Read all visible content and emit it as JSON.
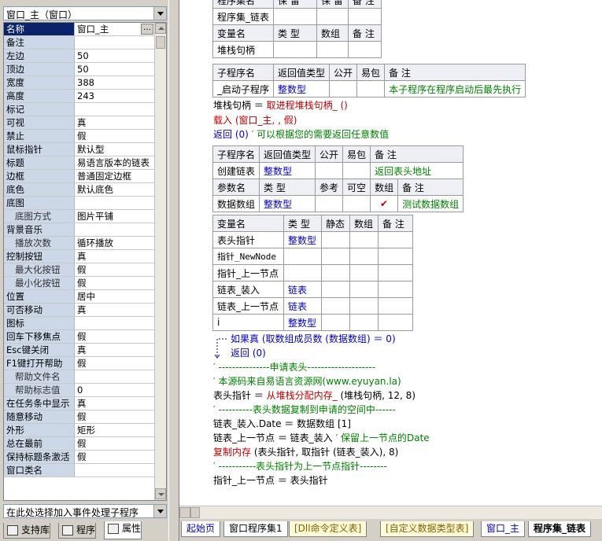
{
  "object_combo": "窗口_主（窗口）",
  "properties": [
    {
      "name": "名称",
      "value": "窗口_主",
      "selected": true,
      "button": "…"
    },
    {
      "name": "备注",
      "value": ""
    },
    {
      "name": "左边",
      "value": "50"
    },
    {
      "name": "顶边",
      "value": "50"
    },
    {
      "name": "宽度",
      "value": "388"
    },
    {
      "name": "高度",
      "value": "243"
    },
    {
      "name": "标记",
      "value": ""
    },
    {
      "name": "可视",
      "value": "真"
    },
    {
      "name": "禁止",
      "value": "假"
    },
    {
      "name": "鼠标指针",
      "value": "默认型"
    },
    {
      "name": "标题",
      "value": "易语言版本的链表"
    },
    {
      "name": "边框",
      "value": "普通固定边框"
    },
    {
      "name": "底色",
      "value": "默认底色"
    },
    {
      "name": "底图",
      "value": ""
    },
    {
      "name": "底图方式",
      "value": "图片平铺",
      "indent": true
    },
    {
      "name": "背景音乐",
      "value": ""
    },
    {
      "name": "播放次数",
      "value": "循环播放",
      "indent": true
    },
    {
      "name": "控制按钮",
      "value": "真"
    },
    {
      "name": "最大化按钮",
      "value": "假",
      "indent": true
    },
    {
      "name": "最小化按钮",
      "value": "假",
      "indent": true
    },
    {
      "name": "位置",
      "value": "居中"
    },
    {
      "name": "可否移动",
      "value": "真"
    },
    {
      "name": "图标",
      "value": ""
    },
    {
      "name": "回车下移焦点",
      "value": "假"
    },
    {
      "name": "Esc键关闭",
      "value": "真"
    },
    {
      "name": "F1键打开帮助",
      "value": "假"
    },
    {
      "name": "帮助文件名",
      "value": "",
      "indent": true
    },
    {
      "name": "帮助标志值",
      "value": "0",
      "indent": true
    },
    {
      "name": "在任务条中显示",
      "value": "真"
    },
    {
      "name": "随意移动",
      "value": "假"
    },
    {
      "name": "外形",
      "value": "矩形"
    },
    {
      "name": "总在最前",
      "value": "假"
    },
    {
      "name": "保持标题条激活",
      "value": "假"
    },
    {
      "name": "窗口类名",
      "value": ""
    }
  ],
  "event_combo": "在此处选择加入事件处理子程序",
  "left_tabs": [
    {
      "label": "支持库",
      "icon": "library-icon"
    },
    {
      "label": "程序",
      "icon": "program-icon"
    },
    {
      "label": "属性",
      "icon": "property-icon",
      "active": true
    }
  ],
  "code": {
    "top_table": {
      "row0": [
        "程序集名",
        "保 留",
        "保 留",
        "备 注"
      ],
      "row1": [
        "程序集_链表",
        "",
        "",
        ""
      ],
      "row2": [
        "变量名",
        "类 型",
        "数组",
        "备 注"
      ],
      "row3": [
        "堆栈句柄",
        "",
        "",
        ""
      ]
    },
    "sub1_table": {
      "header": [
        "子程序名",
        "返回值类型",
        "公开",
        "易包",
        "备 注"
      ],
      "row": [
        "_启动子程序",
        "整数型",
        "",
        "",
        "本子程序在程序启动后最先执行"
      ]
    },
    "sub1_lines": [
      [
        "堆栈句柄 ＝ ",
        "取进程堆栈句柄_ ()"
      ],
      [
        "载入 (窗口_主, , 假)",
        ""
      ],
      [
        "返回 (0)",
        "  ′ 可以根据您的需要返回任意数值"
      ]
    ],
    "sub2_table": {
      "header": [
        "子程序名",
        "返回值类型",
        "公开",
        "易包",
        "备 注"
      ],
      "row": [
        "创建链表",
        "整数型",
        "",
        "",
        "返回表头地址"
      ],
      "param_header": [
        "参数名",
        "类 型",
        "参考",
        "可空",
        "数组",
        "备 注"
      ],
      "param_row": [
        "数据数组",
        "整数型",
        "",
        "",
        "✔",
        "测试数据数组"
      ]
    },
    "var_table": {
      "header": [
        "变量名",
        "类 型",
        "静态",
        "数组",
        "备 注"
      ],
      "rows": [
        [
          "表头指针",
          "整数型"
        ],
        [
          "指针_NewNode",
          ""
        ],
        [
          "指针_上一节点",
          ""
        ],
        [
          "链表_装入",
          "链表"
        ],
        [
          "链表_上一节点",
          "链表"
        ],
        [
          "i",
          "整数型"
        ]
      ]
    },
    "sub2_lines": {
      "if_line": "如果真 (取数组成员数 (数据数组) ＝ 0)",
      "return_line": "返回 (0)",
      "c1": "′ ---------------申请表头--------------------",
      "c2": "′ 本源码来自易语言资源网(www.eyuyan.la)",
      "l1a": "表头指针 ＝ ",
      "l1b": "从堆栈分配内存_",
      "l1c": " (堆栈句柄, 12, 8)",
      "c3": "′ ----------表头数据复制到申请的空间中------",
      "l2": "链表_装入.Date ＝ 数据数组 [1]",
      "l3a": "链表_上一节点 ＝ 链表_装入",
      "l3b": "  ′ 保留上一节点的Date",
      "l4a": "复制内存",
      "l4b": " (表头指针, 取指针 (链表_装入), 8)",
      "c4": "′ -----------表头指针为上一节点指针--------",
      "l5": "指针_上一节点 ＝ 表头指针"
    }
  },
  "doc_tabs": [
    {
      "label": "起始页",
      "style": "blue"
    },
    {
      "label": "窗口程序集1",
      "style": "normal"
    },
    {
      "label": "[Dll命令定义表]",
      "style": "yellow"
    },
    {
      "label": "[自定义数据类型表]",
      "style": "yellow"
    },
    {
      "label": "窗口_主",
      "style": "blue"
    },
    {
      "label": "程序集_链表",
      "style": "active"
    }
  ],
  "colors": {
    "keyword_blue": "#0000c8",
    "comment_green": "#008000",
    "call_red": "#c00000",
    "selected_row": "#0a246a",
    "property_name_bg": "#ccd8e8"
  }
}
